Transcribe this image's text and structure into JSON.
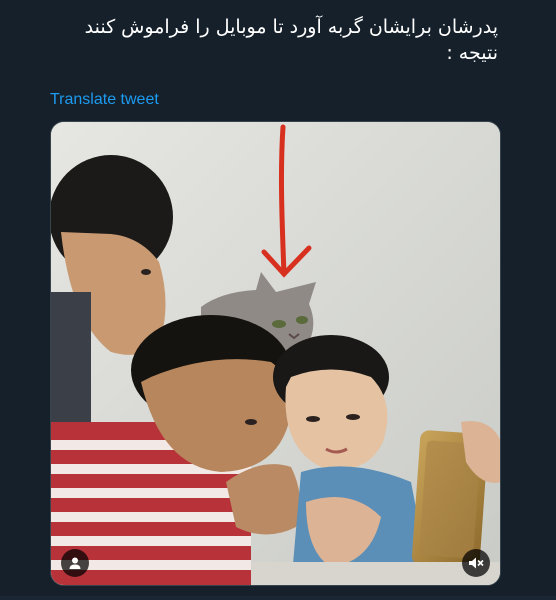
{
  "tweet": {
    "text_line1": "پدرشان برایشان گربه آورد تا موبایل را فراموش کنند",
    "text_line2": "نتیجه :",
    "translate_label": "Translate tweet"
  },
  "media": {
    "alt": "Four boys watching a smartphone while a cat sits behind them, marked by a red arrow",
    "user_tag_icon": "person-icon",
    "mute_icon": "speaker-muted-icon"
  },
  "colors": {
    "background": "#15202b",
    "text": "#ffffff",
    "link": "#1d9bf0",
    "arrow": "#d7301f"
  }
}
